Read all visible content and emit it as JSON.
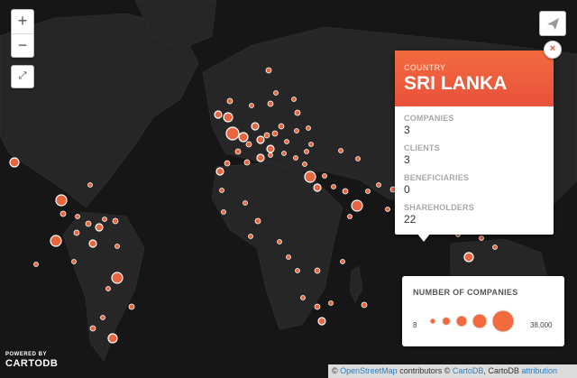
{
  "map": {
    "zoom_in_label": "+",
    "zoom_out_label": "−",
    "fullscreen_label": "⤢",
    "land_color": "#262626",
    "bubble_color": "#f36a3f",
    "bubble_stroke": "#ffffff"
  },
  "popup": {
    "header_label": "COUNTRY",
    "header_value": "SRI LANKA",
    "close_label": "×",
    "fields": [
      {
        "label": "COMPANIES",
        "value": "3"
      },
      {
        "label": "CLIENTS",
        "value": "3"
      },
      {
        "label": "BENEFICIARIES",
        "value": "0"
      },
      {
        "label": "SHAREHOLDERS",
        "value": "22"
      }
    ]
  },
  "legend": {
    "title": "NUMBER OF COMPANIES",
    "min_label": "8",
    "max_label": "38,000"
  },
  "branding": {
    "powered_by": "POWERED BY",
    "logo_text": "CARTODB"
  },
  "attribution": {
    "prefix": "©",
    "osm": "OpenStreetMap",
    "contributors": "contributors ©",
    "cartodb": "CartoDB",
    "middle": ", CartoDB",
    "attribution": "attribution"
  }
}
